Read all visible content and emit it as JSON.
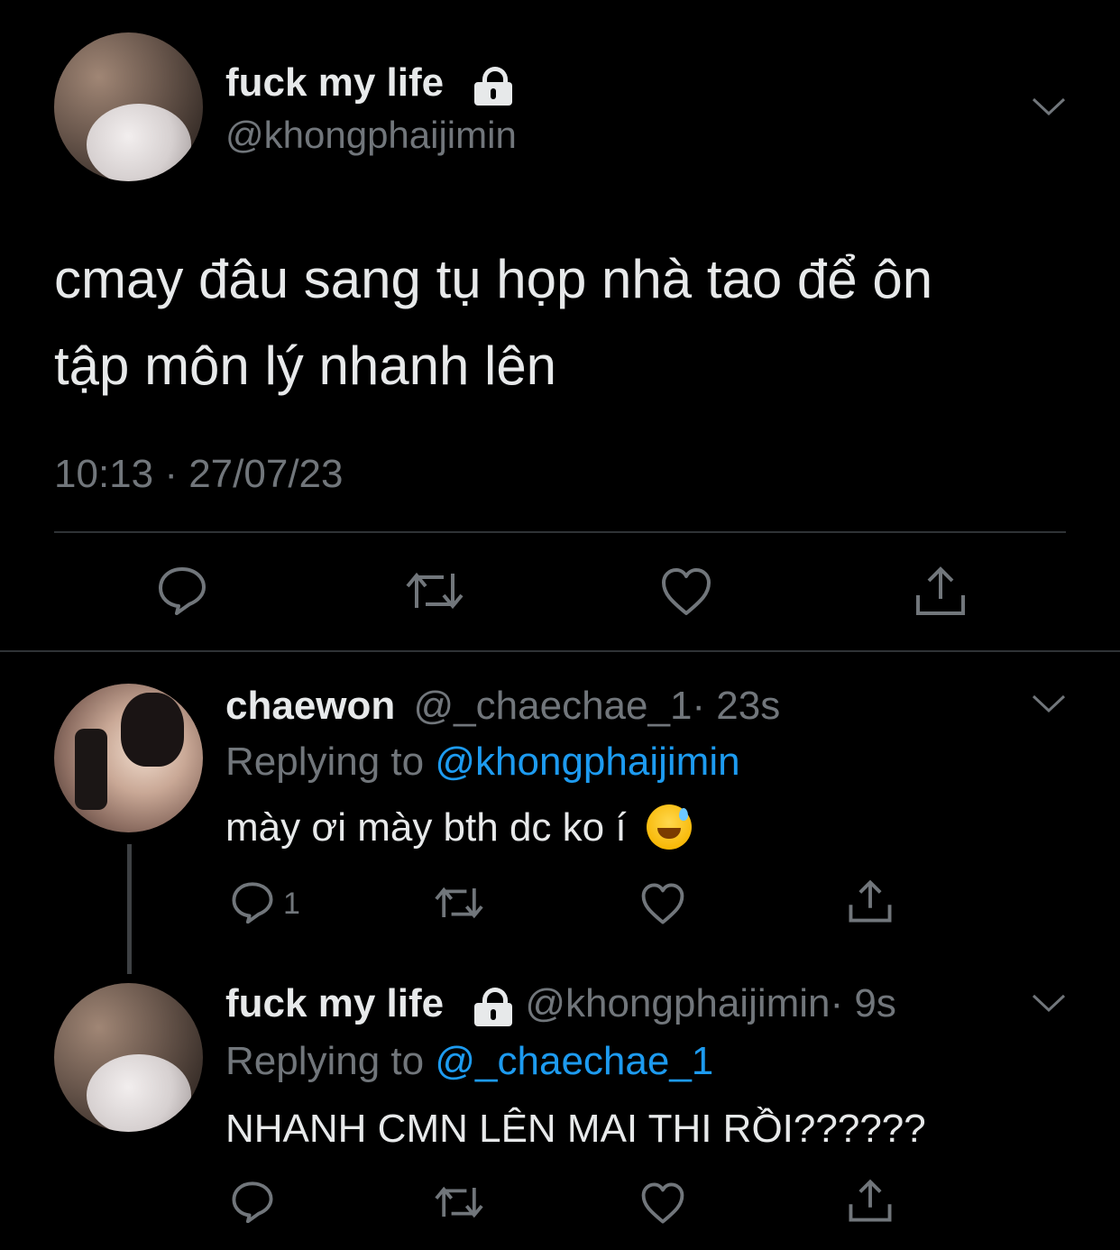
{
  "main_tweet": {
    "display_name": "fuck my life",
    "handle": "@khongphaijimin",
    "text_line1": "cmay đâu sang tụ họp nhà tao để ôn",
    "text_line2": "tập môn lý nhanh lên",
    "timestamp": "10:13 · 27/07/23"
  },
  "reply1": {
    "display_name": "chaewon",
    "handle": "@_chaechae_1",
    "time": "· 23s",
    "replying_prefix": "Replying to",
    "replying_to": "@khongphaijimin",
    "text": "mày ơi mày bth dc ko í",
    "reply_count": "1"
  },
  "reply2": {
    "display_name": "fuck my life",
    "handle": "@khongphaijimin",
    "time": "· 9s",
    "replying_prefix": "Replying to",
    "replying_to": "@_chaechae_1",
    "text": "NHANH CMN LÊN MAI THI RỒI??????"
  },
  "colors": {
    "background": "#000000",
    "text": "#e7e9ea",
    "muted": "#71767b",
    "link": "#1d9bf0"
  },
  "icons": [
    "lock-icon",
    "chevron-down-icon",
    "reply-icon",
    "retweet-icon",
    "like-icon",
    "share-icon",
    "sweat-smile-emoji"
  ]
}
